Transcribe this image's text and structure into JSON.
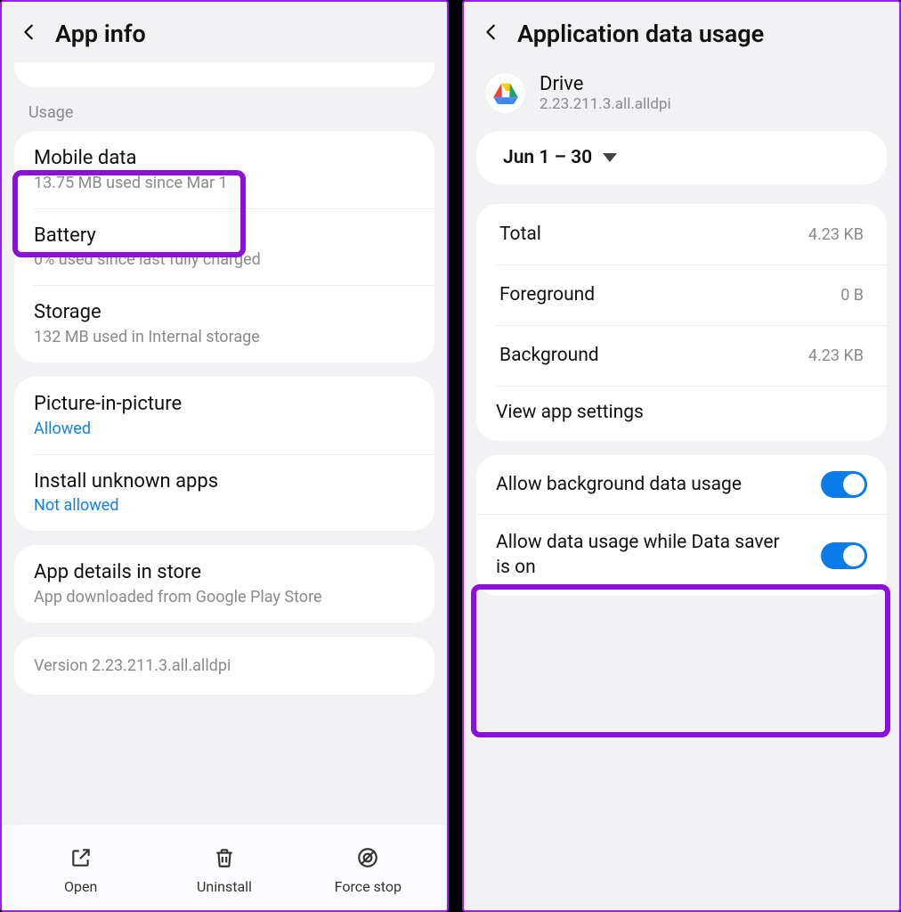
{
  "left": {
    "title": "App info",
    "usage_label": "Usage",
    "mobile_data": {
      "title": "Mobile data",
      "sub": "13.75 MB used since Mar 1"
    },
    "battery": {
      "title": "Battery",
      "sub": "0% used since last fully charged"
    },
    "storage": {
      "title": "Storage",
      "sub": "132 MB used in Internal storage"
    },
    "pip": {
      "title": "Picture-in-picture",
      "sub": "Allowed"
    },
    "unknown": {
      "title": "Install unknown apps",
      "sub": "Not allowed"
    },
    "details": {
      "title": "App details in store",
      "sub": "App downloaded from Google Play Store"
    },
    "version": "Version 2.23.211.3.all.alldpi",
    "actions": {
      "open": "Open",
      "uninstall": "Uninstall",
      "force_stop": "Force stop"
    }
  },
  "right": {
    "title": "Application data usage",
    "app": {
      "name": "Drive",
      "package": "2.23.211.3.all.alldpi"
    },
    "date_range": "Jun 1 – 30",
    "rows": {
      "total": {
        "label": "Total",
        "value": "4.23 KB"
      },
      "foreground": {
        "label": "Foreground",
        "value": "0 B"
      },
      "background": {
        "label": "Background",
        "value": "4.23 KB"
      }
    },
    "view_settings": "View app settings",
    "toggles": {
      "bg_data": {
        "label": "Allow background data usage",
        "on": true
      },
      "data_saver": {
        "label": "Allow data usage while Data saver is on",
        "on": true
      }
    }
  }
}
